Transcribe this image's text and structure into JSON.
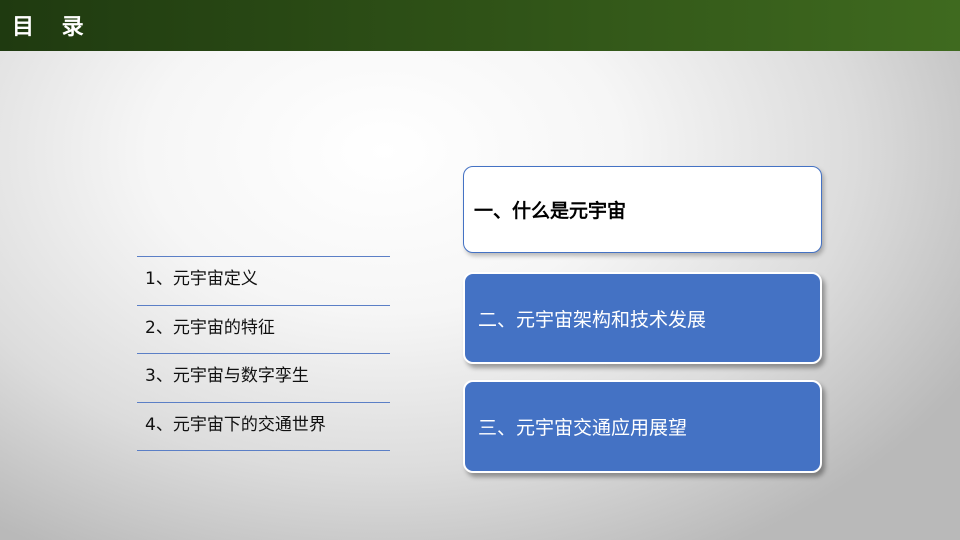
{
  "header": {
    "title": "目 录"
  },
  "sections": [
    {
      "label": "一、什么是元宇宙",
      "active": true
    },
    {
      "label": "二、元宇宙架构和技术发展",
      "active": false
    },
    {
      "label": "三、元宇宙交通应用展望",
      "active": false
    }
  ],
  "subitems": [
    {
      "label": "1、元宇宙定义"
    },
    {
      "label": "2、元宇宙的特征"
    },
    {
      "label": "3、元宇宙与数字孪生"
    },
    {
      "label": "4、元宇宙下的交通世界"
    }
  ],
  "colors": {
    "header_dark": "#1f3a10",
    "header_light": "#3f6a1f",
    "accent_blue": "#4472c4"
  }
}
